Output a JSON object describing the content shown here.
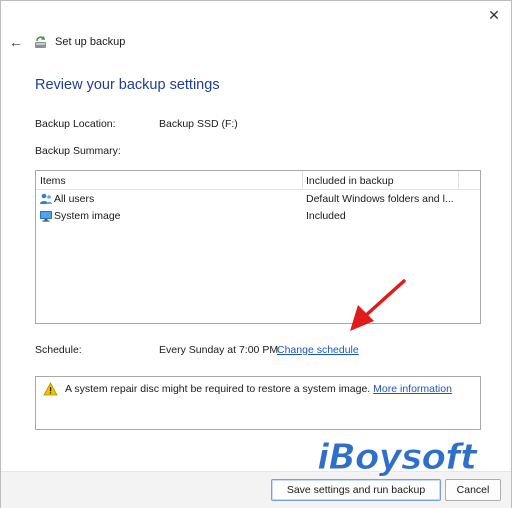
{
  "window": {
    "close_glyph": "✕",
    "back_glyph": "←",
    "title": "Set up backup"
  },
  "heading": "Review your backup settings",
  "backup_location": {
    "label": "Backup Location:",
    "value": "Backup SSD (F:)"
  },
  "backup_summary": {
    "label": "Backup Summary:"
  },
  "summary_table": {
    "columns": [
      "Items",
      "Included in backup"
    ],
    "rows": [
      {
        "icon": "users-icon",
        "name": "All users",
        "included": "Default Windows folders and l..."
      },
      {
        "icon": "monitor-icon",
        "name": "System image",
        "included": "Included"
      }
    ]
  },
  "schedule": {
    "label": "Schedule:",
    "value": "Every Sunday at 7:00 PM",
    "change_link": "Change schedule"
  },
  "notice": {
    "icon": "warning-icon",
    "text": "A system repair disc might be required to restore a system image.",
    "link": "More information"
  },
  "buttons": {
    "primary": "Save settings and run backup",
    "cancel": "Cancel"
  },
  "watermark": "iBoysoft",
  "colors": {
    "heading": "#1e3f8f",
    "link": "#1a55c8",
    "annotation_arrow": "#e01b1b",
    "watermark": "#2f6fc9"
  }
}
